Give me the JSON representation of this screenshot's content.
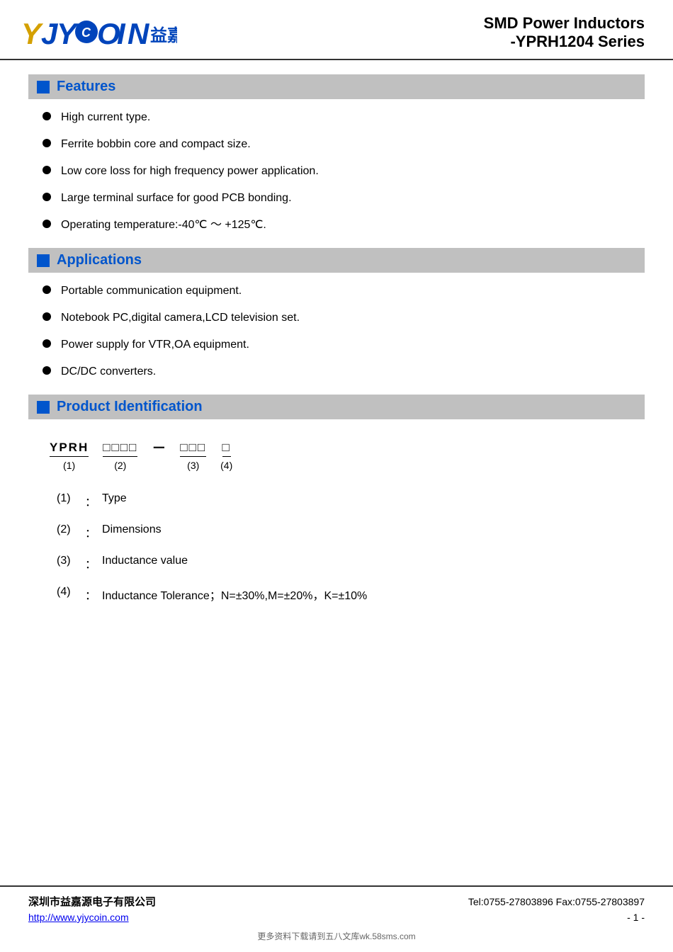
{
  "header": {
    "logo_text": "YJYCOIN",
    "logo_chinese": "益嘉源",
    "title_line1": "SMD Power Inductors",
    "title_line2": "-YPRH1204 Series"
  },
  "features": {
    "section_label": "Features",
    "items": [
      "High current type.",
      "Ferrite bobbin core and compact size.",
      "Low core loss for high frequency power application.",
      "Large terminal surface for good PCB bonding.",
      "Operating temperature:-40℃ ～ +125℃."
    ]
  },
  "applications": {
    "section_label": "Applications",
    "items": [
      "Portable communication equipment.",
      "Notebook PC,digital camera,LCD television set.",
      "Power supply for VTR,OA equipment.",
      "DC/DC converters."
    ]
  },
  "product_identification": {
    "section_label": "Product Identification",
    "diagram": {
      "part1_value": "YPRH",
      "part1_label": "(1)",
      "part2_value": "□□□□",
      "part2_label": "(2)",
      "dash": "－",
      "part3_value": "□□□",
      "part3_label": "(3)",
      "part4_value": "□",
      "part4_label": "(4)"
    },
    "id_items": [
      {
        "num": "(1)",
        "desc": "Type"
      },
      {
        "num": "(2)",
        "desc": "Dimensions"
      },
      {
        "num": "(3)",
        "desc": "Inductance value"
      },
      {
        "num": "(4)",
        "desc": "Inductance Tolerance；N=±30%,M=±20%，K=±10%"
      }
    ]
  },
  "footer": {
    "company": "深圳市益嘉源电子有限公司",
    "contact": "Tel:0755-27803896   Fax:0755-27803897",
    "url": "http://www.yjycoin.com",
    "page": "- 1 -",
    "watermark": "更多资料下载请到五八文库wk.58sms.com"
  }
}
